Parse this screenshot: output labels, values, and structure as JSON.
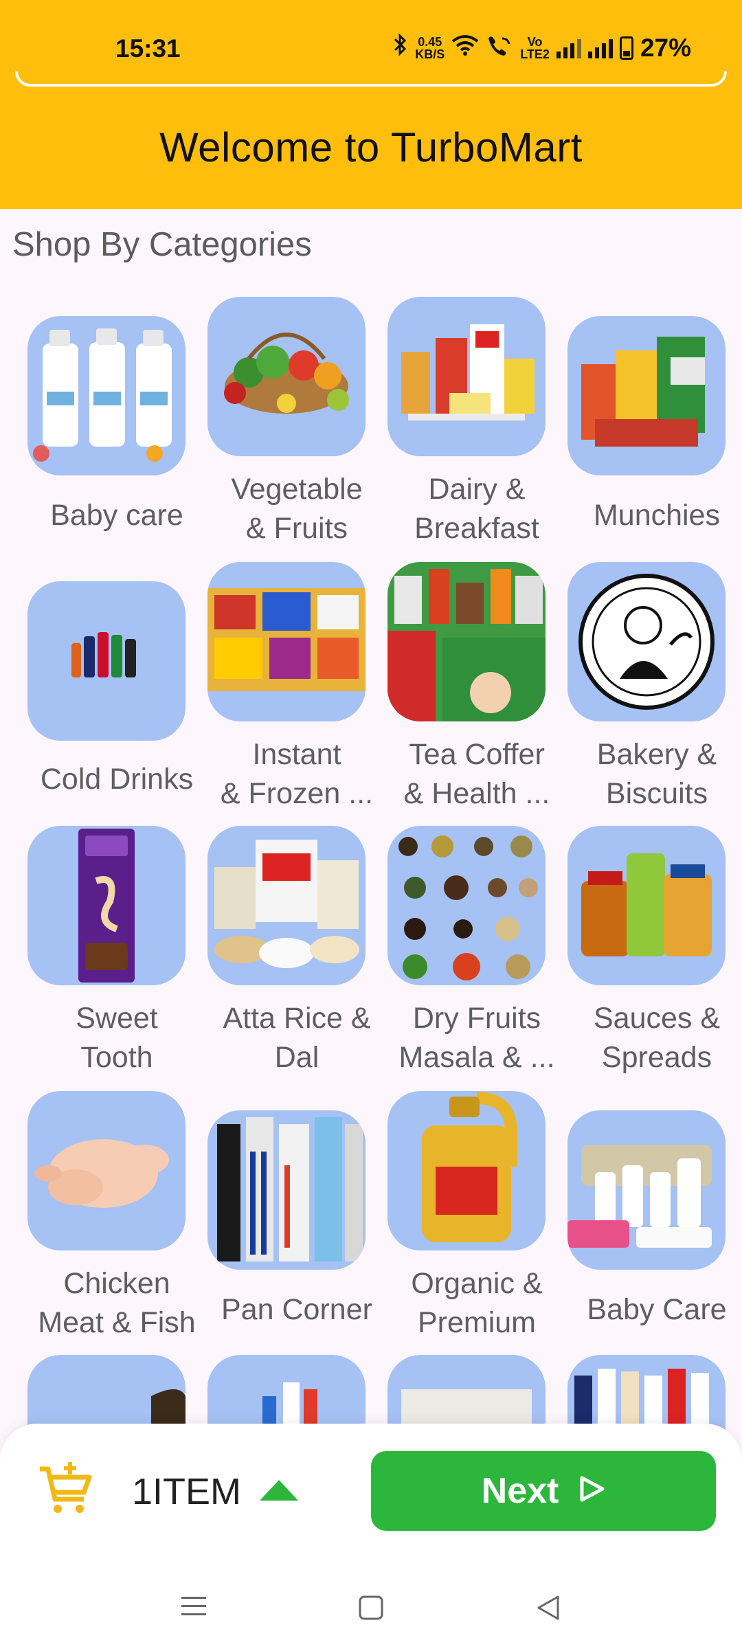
{
  "status_bar": {
    "time": "15:31",
    "speed_value": "0.45",
    "speed_unit": "KB/S",
    "volte_label_1": "Vo",
    "volte_label_2": "LTE2",
    "battery": "27%"
  },
  "header": {
    "title": "Welcome to TurboMart"
  },
  "section_title": "Shop By Categories",
  "colors": {
    "header_bg": "#ffbe0c",
    "tile_bg": "#a6c1f3",
    "next_button": "#2db63c",
    "cart_icon": "#f0b915"
  },
  "categories": [
    {
      "line1": "Baby care",
      "line2": ""
    },
    {
      "line1": "Vegetable",
      "line2": "& Fruits"
    },
    {
      "line1": "Dairy &",
      "line2": "Breakfast"
    },
    {
      "line1": "Munchies",
      "line2": ""
    },
    {
      "line1": "Cold Drinks",
      "line2": ""
    },
    {
      "line1": "Instant",
      "line2": "& Frozen ..."
    },
    {
      "line1": "Tea Coffer",
      "line2": "& Health ..."
    },
    {
      "line1": "Bakery &",
      "line2": "Biscuits"
    },
    {
      "line1": "Sweet",
      "line2": "Tooth"
    },
    {
      "line1": "Atta Rice &",
      "line2": "Dal"
    },
    {
      "line1": "Dry Fruits",
      "line2": "Masala & ..."
    },
    {
      "line1": "Sauces &",
      "line2": "Spreads"
    },
    {
      "line1": "Chicken",
      "line2": "Meat & Fish"
    },
    {
      "line1": "Pan Corner",
      "line2": ""
    },
    {
      "line1": "Organic &",
      "line2": "Premium"
    },
    {
      "line1": "Baby Care",
      "line2": ""
    }
  ],
  "cart": {
    "count_label": "1ITEM",
    "next_label": "Next"
  },
  "icons": {
    "cart": "add-shopping-cart-icon",
    "expand": "triangle-up-icon",
    "next": "play-arrow-icon",
    "nav_menu": "menu-icon",
    "nav_home": "square-icon",
    "nav_back": "back-triangle-icon"
  }
}
